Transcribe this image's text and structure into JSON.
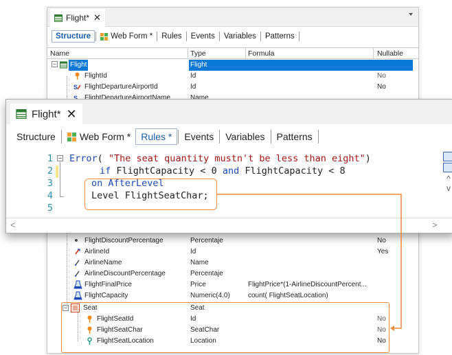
{
  "back_window": {
    "tab_title": "Flight",
    "tab_modified_mark": "*",
    "close_glyph": "✕",
    "subtabs": [
      {
        "label": "Structure",
        "active": true
      },
      {
        "label": "Web Form *",
        "active": false
      },
      {
        "label": "Rules",
        "active": false
      },
      {
        "label": "Events",
        "active": false
      },
      {
        "label": "Variables",
        "active": false
      },
      {
        "label": "Patterns",
        "active": false
      }
    ],
    "columns": {
      "name": "Name",
      "type": "Type",
      "formula": "Formula",
      "nullable": "Nullable"
    },
    "top_rows": [
      {
        "name": "Flight",
        "type": "Flight",
        "formula": "",
        "nullable": "",
        "icon": "transaction-icon",
        "selected": true
      },
      {
        "name": "FlightId",
        "type": "Id",
        "formula": "",
        "nullable": "No",
        "icon": "key-icon"
      },
      {
        "name": "FlightDepartureAirportId",
        "type": "Id",
        "formula": "",
        "nullable": "No",
        "icon": "foreign-key-icon"
      },
      {
        "name": "FlightDepartureAirportName",
        "type": "Name",
        "formula": "",
        "nullable": "",
        "icon": "inferred-icon"
      }
    ],
    "bottom_rows": [
      {
        "name": "FlightDiscountPercentage",
        "type": "Percentaje",
        "formula": "",
        "nullable": "No",
        "icon": "attribute-icon"
      },
      {
        "name": "AirlineId",
        "type": "Id",
        "formula": "",
        "nullable": "Yes",
        "icon": "foreign-key-icon"
      },
      {
        "name": "AirlineName",
        "type": "Name",
        "formula": "",
        "nullable": "",
        "icon": "inferred-icon"
      },
      {
        "name": "AirlineDiscountPercentage",
        "type": "Percentaje",
        "formula": "",
        "nullable": "",
        "icon": "inferred-icon"
      },
      {
        "name": "FlightFinalPrice",
        "type": "Price",
        "formula": "FlightPrice*(1-AirlineDiscountPercent...",
        "nullable": "",
        "icon": "formula-icon"
      },
      {
        "name": "FlightCapacity",
        "type": "Numeric(4.0)",
        "formula": "count( FlightSeatLocation)",
        "nullable": "",
        "icon": "formula-icon"
      },
      {
        "name": "Seat",
        "type": "Seat",
        "formula": "",
        "nullable": "",
        "icon": "level-icon"
      },
      {
        "name": "FlightSeatId",
        "type": "Id",
        "formula": "",
        "nullable": "No",
        "icon": "key-icon"
      },
      {
        "name": "FlightSeatChar",
        "type": "SeatChar",
        "formula": "",
        "nullable": "No",
        "icon": "key-icon"
      },
      {
        "name": "FlightSeatLocation",
        "type": "Location",
        "formula": "",
        "nullable": "No",
        "icon": "candidate-key-icon"
      }
    ]
  },
  "front_window": {
    "tab_title": "Flight",
    "tab_modified_mark": "*",
    "close_glyph": "✕",
    "subtabs": [
      {
        "label": "Structure",
        "active": false
      },
      {
        "label": "Web Form *",
        "active": false
      },
      {
        "label": "Rules *",
        "active": true
      },
      {
        "label": "Events",
        "active": false
      },
      {
        "label": "Variables",
        "active": false
      },
      {
        "label": "Patterns",
        "active": false
      }
    ],
    "line_numbers": [
      "1",
      "2",
      "3",
      "4",
      "5"
    ],
    "code": {
      "l1_kw": "Error",
      "l1_open": "( ",
      "l1_str": "\"The seat quantity mustn't be less than eight\"",
      "l1_close": ")",
      "l2_kw1": "if",
      "l2_mid": " FlightCapacity < 0 ",
      "l2_kw2": "and",
      "l2_end": " FlightCapacity < 8",
      "l3_kw": "on",
      "l3_rest": " AfterLevel",
      "l4_kw": "Level",
      "l4_rest": " FlightSeatChar;"
    },
    "scroll_left_glyph": "<",
    "scroll_right_glyph": ">",
    "scroll_up_glyph": "^",
    "scroll_down_glyph": "v"
  },
  "colors": {
    "accent": "#0a78d7",
    "callout": "#f08a3c",
    "keyword": "#1c48b8",
    "string": "#a31515",
    "line_number": "#2b91af"
  }
}
